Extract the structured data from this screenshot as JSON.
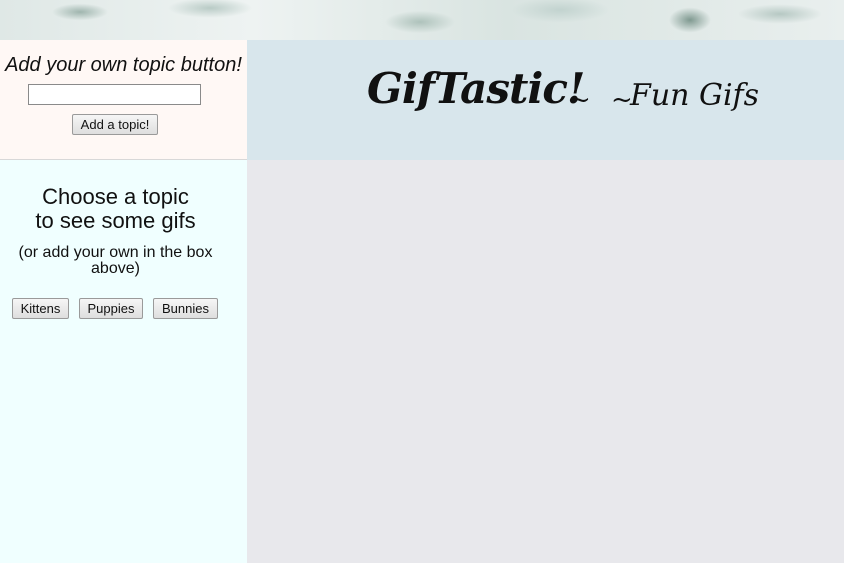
{
  "add_panel": {
    "title": "Add your own topic button!",
    "input_value": "",
    "add_button_label": "Add a topic!"
  },
  "choose_panel": {
    "title_line1": "Choose a topic",
    "title_line2": "to see some gifs",
    "subtitle": "(or add your own in the box above)",
    "topics": [
      "Kittens",
      "Puppies",
      "Bunnies"
    ]
  },
  "header": {
    "brand": "GifTastic!",
    "separator": "~ ~",
    "tagline": "Fun Gifs"
  },
  "colors": {
    "add_panel_bg": "#fff8f5",
    "choose_panel_bg": "#f0ffff",
    "header_bg": "#d8e6ec",
    "gif_area_bg": "#e8e8ec"
  }
}
